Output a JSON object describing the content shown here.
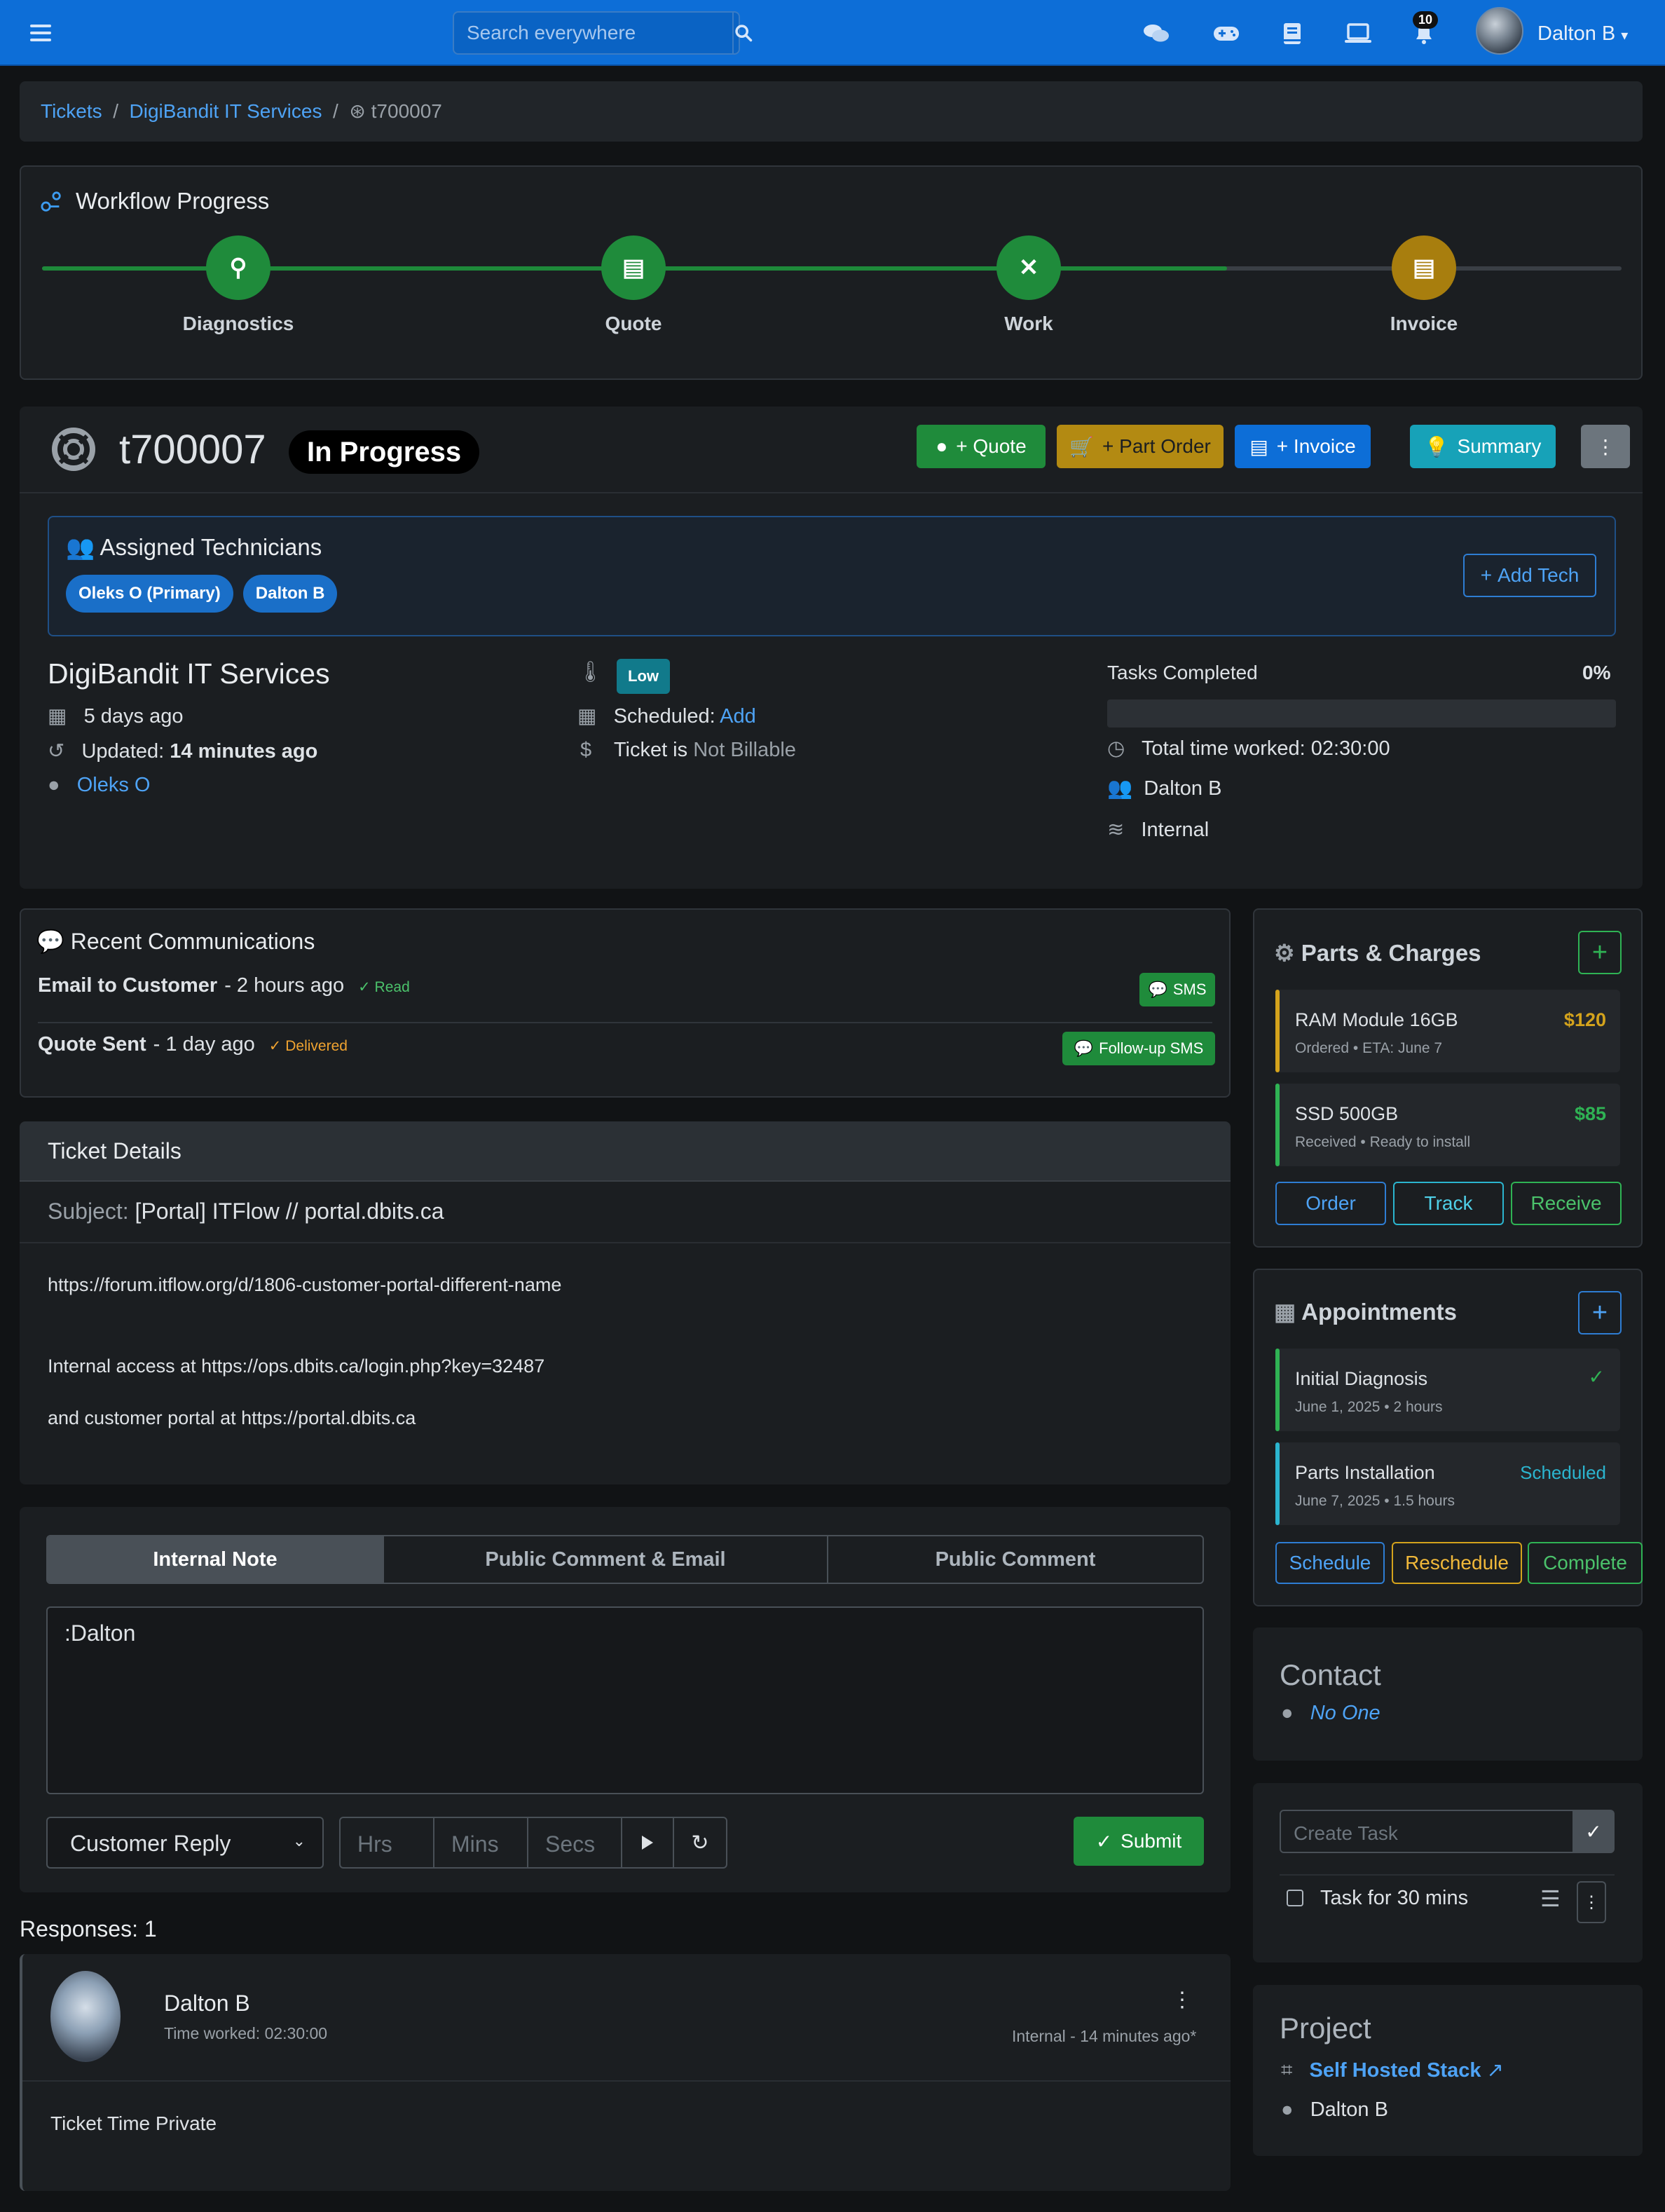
{
  "topbar": {
    "search_placeholder": "Search everywhere",
    "notifications_count": "10",
    "user_name": "Dalton B"
  },
  "breadcrumb": {
    "items": [
      "Tickets",
      "DigiBandit IT Services"
    ],
    "current": "t700007"
  },
  "workflow": {
    "title": "Workflow Progress",
    "steps": [
      "Diagnostics",
      "Quote",
      "Work",
      "Invoice"
    ],
    "progress_fraction": 0.75,
    "colors": {
      "done": "#1f8b3b",
      "current": "#a87e0e",
      "line_done": "#1e8a3a",
      "line_pending": "#3a3f45"
    }
  },
  "ticket": {
    "number": "t700007",
    "status": "In Progress",
    "actions": {
      "quote": "+ Quote",
      "part_order": "+ Part Order",
      "invoice": "+ Invoice",
      "summary": "Summary"
    }
  },
  "technicians": {
    "title": "Assigned Technicians",
    "list": [
      "Oleks O (Primary)",
      "Dalton B"
    ],
    "add_label": "Add Tech"
  },
  "info": {
    "client": "DigiBandit IT Services",
    "created": "5 days ago",
    "updated_label": "Updated:",
    "updated_value": "14 minutes ago",
    "owner": "Oleks O",
    "priority": "Low",
    "scheduled_label": "Scheduled:",
    "scheduled_action": "Add",
    "billable_label": "Ticket is",
    "billable_value": "Not Billable",
    "tasks_label": "Tasks Completed",
    "tasks_percent": "0%",
    "tasks_fraction": 0,
    "time_worked": "Total time worked: 02:30:00",
    "assignee": "Dalton B",
    "category": "Internal"
  },
  "communications": {
    "title": "Recent Communications",
    "items": [
      {
        "title": "Email to Customer",
        "time": "- 2 hours ago",
        "status": "Read",
        "action": "SMS"
      },
      {
        "title": "Quote Sent",
        "time": "- 1 day ago",
        "status": "Delivered",
        "action": "Follow-up SMS"
      }
    ]
  },
  "details": {
    "header": "Ticket Details",
    "subject_label": "Subject:",
    "subject": "[Portal] ITFlow // portal.dbits.ca",
    "body": [
      "https://forum.itflow.org/d/1806-customer-portal-different-name",
      "Internal access at https://ops.dbits.ca/login.php?key=32487",
      "and customer portal at https://portal.dbits.ca"
    ]
  },
  "reply": {
    "tabs": [
      "Internal Note",
      "Public Comment & Email",
      "Public Comment"
    ],
    "text": ":Dalton",
    "status_option": "Customer Reply",
    "hrs_placeholder": "Hrs",
    "mins_placeholder": "Mins",
    "secs_placeholder": "Secs",
    "submit": "Submit"
  },
  "responses": {
    "heading": "Responses: 1",
    "items": [
      {
        "author": "Dalton B",
        "time_worked": "Time worked: 02:30:00",
        "meta": "Internal - 14 minutes ago*",
        "body": "Ticket Time Private"
      }
    ]
  },
  "parts": {
    "title": "Parts & Charges",
    "items": [
      {
        "name": "RAM Module 16GB",
        "price": "$120",
        "status": "Ordered",
        "detail": "ETA: June 7",
        "color": "#d4a31c"
      },
      {
        "name": "SSD 500GB",
        "price": "$85",
        "status": "Received",
        "detail": "Ready to install",
        "color": "#2fb354"
      }
    ],
    "buttons": [
      "Order",
      "Track",
      "Receive"
    ]
  },
  "appointments": {
    "title": "Appointments",
    "items": [
      {
        "name": "Initial Diagnosis",
        "date": "June 1, 2025",
        "duration": "2 hours",
        "status": "",
        "color": "#2fb354"
      },
      {
        "name": "Parts Installation",
        "date": "June 7, 2025",
        "duration": "1.5 hours",
        "status": "Scheduled",
        "color": "#2bb5cf"
      }
    ],
    "buttons": [
      "Schedule",
      "Reschedule",
      "Complete"
    ]
  },
  "contact": {
    "title": "Contact",
    "name": "No One"
  },
  "tasks": {
    "placeholder": "Create Task",
    "items": [
      "Task for 30 mins"
    ]
  },
  "project": {
    "title": "Project",
    "name": "Self Hosted Stack",
    "owner": "Dalton B"
  }
}
